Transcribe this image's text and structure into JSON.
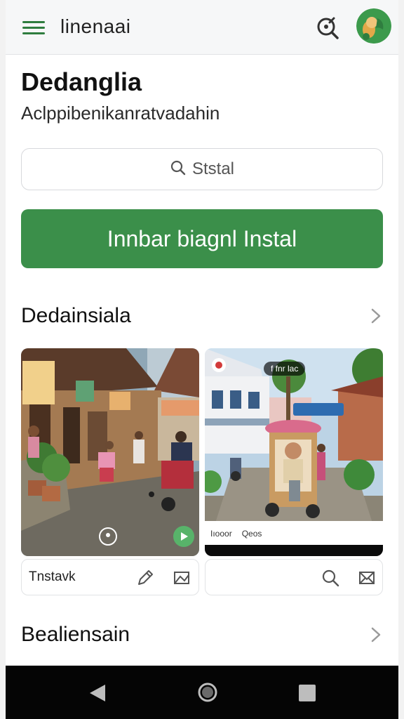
{
  "app": {
    "title": "linenaai"
  },
  "header": {
    "title": "Dedanglia",
    "subtitle": "Aclppibenikanratvadahin"
  },
  "search": {
    "placeholder": "Ststal"
  },
  "install": {
    "label": "Innbar biagnl  Instal"
  },
  "sections": [
    {
      "label": "Dedainsiala"
    },
    {
      "label": "Bealiensain"
    }
  ],
  "cards": [
    {
      "footer_label": "Tnstavk",
      "icons": [
        "pencil-icon",
        "image-icon"
      ]
    },
    {
      "footer_label": "",
      "icons": [
        "search-icon",
        "image-icon"
      ],
      "overlay_top": "f fnr lac",
      "strip_items": [
        "Iıooor",
        "Qeos"
      ]
    }
  ],
  "icons": {
    "menu": "hamburger-menu-icon",
    "search": "search-icon",
    "chevron": "chevron-right-icon",
    "back": "back-triangle-icon",
    "home": "home-circle-icon",
    "recent": "recent-apps-square-icon"
  },
  "colors": {
    "accent": "#3b8f4a",
    "menu_green": "#2f7d3f",
    "navbar": "#050505"
  }
}
